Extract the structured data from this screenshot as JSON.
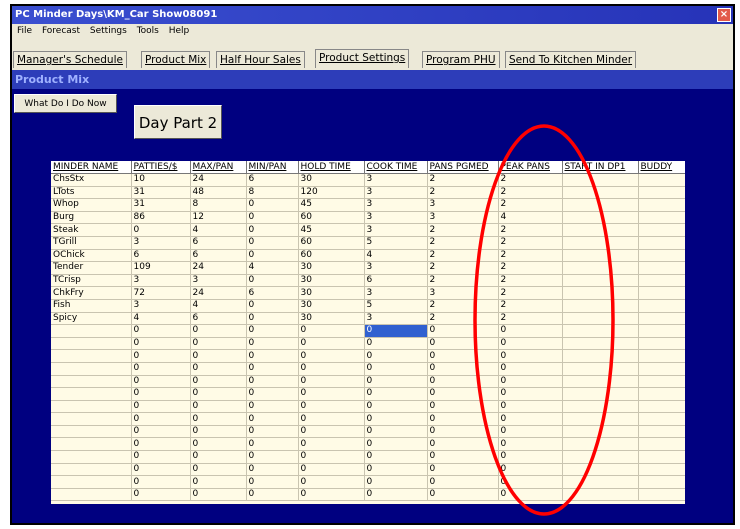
{
  "window": {
    "title": "PC Minder  Days\\KM_Car Show08091",
    "close_glyph": "×"
  },
  "menu": [
    "File",
    "Forecast",
    "Settings",
    "Tools",
    "Help"
  ],
  "tabs": [
    {
      "label": "Manager's Schedule"
    },
    {
      "label": "Product Mix"
    },
    {
      "label": "Half Hour Sales"
    },
    {
      "label": "Product Settings"
    },
    {
      "label": "Program PHU"
    },
    {
      "label": "Send To Kitchen Minder"
    }
  ],
  "active_tab": "Product Settings",
  "panel": {
    "title": "Product Mix"
  },
  "buttons": {
    "what": "What Do I Do Now",
    "day_part": "Day Part 2"
  },
  "table": {
    "headers": [
      "MINDER NAME",
      "PATTIES/$",
      "MAX/PAN",
      "MIN/PAN",
      "HOLD TIME",
      "COOK TIME",
      "PANS PGMED",
      "PEAK PANS",
      "START IN DP1",
      "BUDDY"
    ],
    "rows": [
      [
        "ChsStx",
        "10",
        "24",
        "6",
        "30",
        "3",
        "2",
        "2",
        "",
        ""
      ],
      [
        "LTots",
        "31",
        "48",
        "8",
        "120",
        "3",
        "2",
        "2",
        "",
        ""
      ],
      [
        "Whop",
        "31",
        "8",
        "0",
        "45",
        "3",
        "3",
        "2",
        "",
        ""
      ],
      [
        "Burg",
        "86",
        "12",
        "0",
        "60",
        "3",
        "3",
        "4",
        "",
        ""
      ],
      [
        "Steak",
        "0",
        "4",
        "0",
        "45",
        "3",
        "2",
        "2",
        "",
        ""
      ],
      [
        "TGrill",
        "3",
        "6",
        "0",
        "60",
        "5",
        "2",
        "2",
        "",
        ""
      ],
      [
        "OChick",
        "6",
        "6",
        "0",
        "60",
        "4",
        "2",
        "2",
        "",
        ""
      ],
      [
        "Tender",
        "109",
        "24",
        "4",
        "30",
        "3",
        "2",
        "2",
        "",
        ""
      ],
      [
        "TCrisp",
        "3",
        "3",
        "0",
        "30",
        "6",
        "2",
        "2",
        "",
        ""
      ],
      [
        "ChkFry",
        "72",
        "24",
        "6",
        "30",
        "3",
        "3",
        "2",
        "",
        ""
      ],
      [
        "Fish",
        "3",
        "4",
        "0",
        "30",
        "5",
        "2",
        "2",
        "",
        ""
      ],
      [
        "Spicy",
        "4",
        "6",
        "0",
        "30",
        "3",
        "2",
        "2",
        "",
        ""
      ],
      [
        "",
        "0",
        "0",
        "0",
        "0",
        "0",
        "0",
        "0",
        "",
        ""
      ],
      [
        "",
        "0",
        "0",
        "0",
        "0",
        "0",
        "0",
        "0",
        "",
        ""
      ],
      [
        "",
        "0",
        "0",
        "0",
        "0",
        "0",
        "0",
        "0",
        "",
        ""
      ],
      [
        "",
        "0",
        "0",
        "0",
        "0",
        "0",
        "0",
        "0",
        "",
        ""
      ],
      [
        "",
        "0",
        "0",
        "0",
        "0",
        "0",
        "0",
        "0",
        "",
        ""
      ],
      [
        "",
        "0",
        "0",
        "0",
        "0",
        "0",
        "0",
        "0",
        "",
        ""
      ],
      [
        "",
        "0",
        "0",
        "0",
        "0",
        "0",
        "0",
        "0",
        "",
        ""
      ],
      [
        "",
        "0",
        "0",
        "0",
        "0",
        "0",
        "0",
        "0",
        "",
        ""
      ],
      [
        "",
        "0",
        "0",
        "0",
        "0",
        "0",
        "0",
        "0",
        "",
        ""
      ],
      [
        "",
        "0",
        "0",
        "0",
        "0",
        "0",
        "0",
        "0",
        "",
        ""
      ],
      [
        "",
        "0",
        "0",
        "0",
        "0",
        "0",
        "0",
        "0",
        "",
        ""
      ],
      [
        "",
        "0",
        "0",
        "0",
        "0",
        "0",
        "0",
        "0",
        "",
        ""
      ],
      [
        "",
        "0",
        "0",
        "0",
        "0",
        "0",
        "0",
        "0",
        "",
        ""
      ],
      [
        "",
        "0",
        "0",
        "0",
        "0",
        "0",
        "0",
        "0",
        "",
        ""
      ]
    ],
    "selected_cell": {
      "row": 12,
      "col": 5
    }
  },
  "colors": {
    "background": "#000080",
    "annotation": "#ff0000"
  }
}
